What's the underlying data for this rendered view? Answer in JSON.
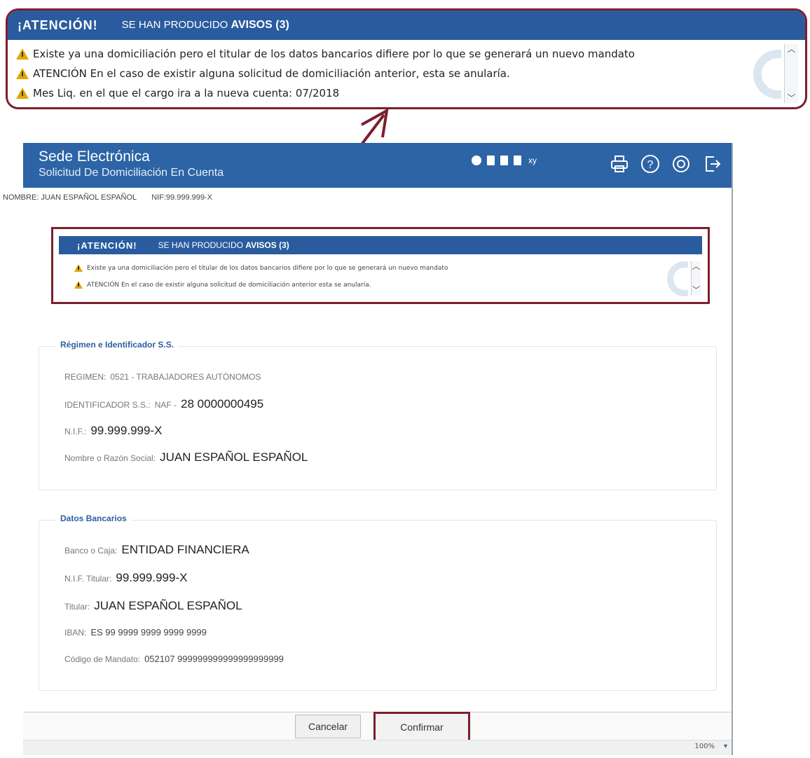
{
  "callout": {
    "attention": "¡ATENCIÓN!",
    "subtitle": "SE HAN PRODUCIDO",
    "avisos": "AVISOS (3)",
    "messages": [
      "Existe ya una domiciliación pero el titular de los datos bancarios difiere por lo que se generará un nuevo mandato",
      "ATENCIÓN En el caso de existir alguna solicitud de domiciliación anterior, esta se anularía.",
      "Mes Liq. en el que el cargo ira a la nueva cuenta: 07/2018"
    ]
  },
  "header": {
    "title": "Sede Electrónica",
    "subtitle": "Solicitud De Domiciliación En Cuenta",
    "xy_label": "xy"
  },
  "user": {
    "name": "NOMBRE: JUAN ESPAÑOL ESPAÑOL",
    "nif": "NIF:99.999.999-X"
  },
  "inner_warning": {
    "attention": "¡ATENCIÓN!",
    "subtitle": "SE HAN PRODUCIDO",
    "avisos": "AVISOS (3)",
    "messages": [
      "Existe ya una domiciliación pero el titular de los datos bancarios difiere por lo que se generará un nuevo mandato",
      "ATENCIÓN En el caso de existir alguna solicitud de domiciliación anterior esta se anularía."
    ]
  },
  "regimen": {
    "legend": "Régimen e Identificador S.S.",
    "regimen_label": "REGIMEN:",
    "regimen_value": "0521 - TRABAJADORES AUTÓNOMOS",
    "identificador_label": "IDENTIFICADOR S.S.:",
    "identificador_prefix": "NAF -",
    "identificador_value": "28 0000000495",
    "nif_label": "N.I.F.:",
    "nif_value": "99.999.999-X",
    "nombre_label": "Nombre o Razón Social:",
    "nombre_value": "JUAN ESPAÑOL ESPAÑOL"
  },
  "bancarios": {
    "legend": "Datos Bancarios",
    "banco_label": "Banco o Caja:",
    "banco_value": "ENTIDAD FINANCIERA",
    "nif_titular_label": "N.I.F. Titular:",
    "nif_titular_value": "99.999.999-X",
    "titular_label": "Titular:",
    "titular_value": "JUAN ESPAÑOL ESPAÑOL",
    "iban_label": "IBAN:",
    "iban_value": "ES 99 9999 9999 9999 9999",
    "mandato_label": "Código de Mandato:",
    "mandato_value": "052107 999999999999999999999"
  },
  "buttons": {
    "cancel": "Cancelar",
    "confirm": "Confirmar"
  },
  "status": {
    "zoom": "100%",
    "zoom_arrow": "▾"
  },
  "colors": {
    "header_blue": "#2d64a6",
    "highlight_border": "#7b1f2e",
    "warning_yellow": "#e0a800"
  }
}
